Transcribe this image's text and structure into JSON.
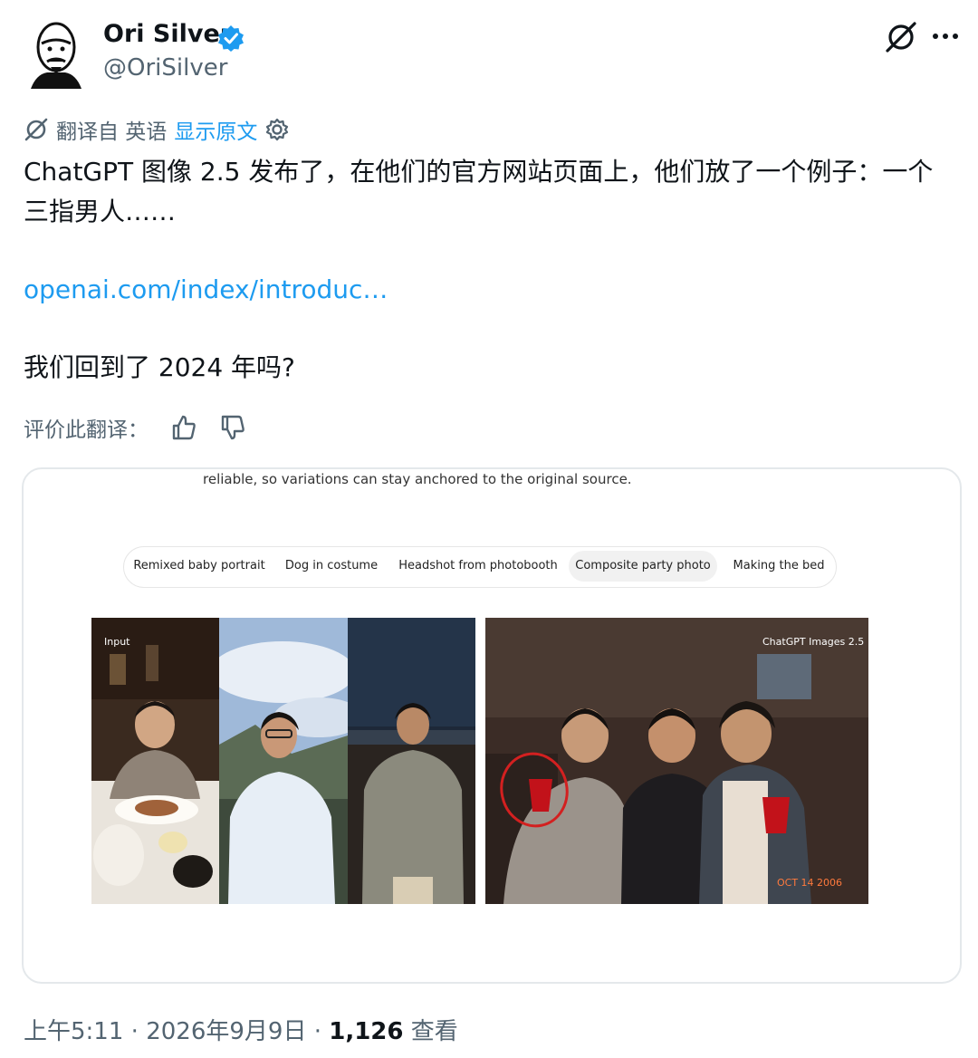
{
  "author": {
    "display_name": "Ori Silver",
    "handle": "@OriSilver",
    "verified": true
  },
  "icons": {
    "avatar": "avatar",
    "verified": "verified-badge-icon",
    "grok": "grok-icon",
    "more": "more-icon",
    "translate": "translate-icon",
    "settings": "gear-icon",
    "thumbs_up": "thumbs-up-icon",
    "thumbs_down": "thumbs-down-icon"
  },
  "translation": {
    "source_label": "翻译自 英语",
    "show_original": "显示原文",
    "rate_label": "评价此翻译："
  },
  "tweet": {
    "text_line": "ChatGPT 图像 2.5 发布了，在他们的官方网站页面上，他们放了一个例子：一个三指男人……",
    "link": "openai.com/index/introduc…",
    "question": "我们回到了 2024 年吗?"
  },
  "media": {
    "caption": "reliable, so variations can stay anchored to the original source.",
    "tabs": [
      {
        "label": "Remixed baby portrait",
        "active": false
      },
      {
        "label": "Dog in costume",
        "active": false
      },
      {
        "label": "Headshot from photobooth",
        "active": false
      },
      {
        "label": "Composite party photo",
        "active": true
      },
      {
        "label": "Making the bed",
        "active": false
      }
    ],
    "input_label": "Input",
    "output_label": "ChatGPT Images 2.5",
    "date_stamp": "OCT 14 2006"
  },
  "footer": {
    "time": "上午5:11",
    "date": "2026年9月9日",
    "views": "1,126",
    "views_label": "查看"
  },
  "colors": {
    "link": "#1d9bf0",
    "secondary_text": "#536471",
    "primary_text": "#0f1419",
    "annotation_circle": "#d32020"
  }
}
